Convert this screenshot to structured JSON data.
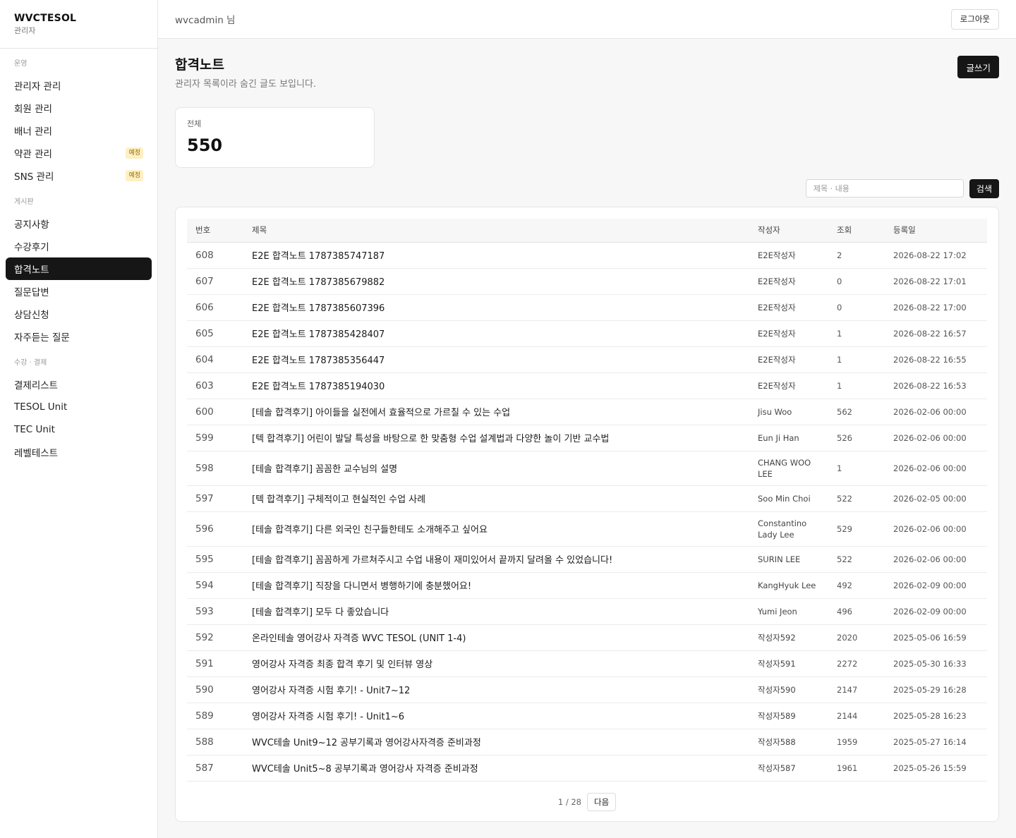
{
  "brand": {
    "name": "WVCTESOL",
    "sub": "관리자"
  },
  "sidebar": {
    "sections": [
      {
        "label": "운영",
        "items": [
          {
            "label": "관리자 관리"
          },
          {
            "label": "회원 관리"
          },
          {
            "label": "배너 관리"
          },
          {
            "label": "약관 관리",
            "badge": "예정"
          },
          {
            "label": "SNS 관리",
            "badge": "예정"
          }
        ]
      },
      {
        "label": "게시판",
        "items": [
          {
            "label": "공지사항"
          },
          {
            "label": "수강후기"
          },
          {
            "label": "합격노트",
            "active": true
          },
          {
            "label": "질문답변"
          },
          {
            "label": "상담신청"
          },
          {
            "label": "자주듣는 질문"
          }
        ]
      },
      {
        "label": "수강 · 결제",
        "items": [
          {
            "label": "결제리스트"
          },
          {
            "label": "TESOL Unit"
          },
          {
            "label": "TEC Unit"
          },
          {
            "label": "레벨테스트"
          }
        ]
      }
    ]
  },
  "topbar": {
    "user": "wvcadmin 님",
    "logout_label": "로그아웃"
  },
  "page": {
    "title": "합격노트",
    "description": "관리자 목록이라 숨긴 글도 보입니다.",
    "write_label": "글쓰기"
  },
  "stats": {
    "label": "전체",
    "value": "550"
  },
  "search": {
    "placeholder": "제목 · 내용",
    "button_label": "검색"
  },
  "table": {
    "columns": [
      "번호",
      "제목",
      "작성자",
      "조회",
      "등록일"
    ],
    "rows": [
      {
        "num": "608",
        "title": "E2E 합격노트 1787385747187",
        "author": "E2E작성자",
        "views": "2",
        "date": "2026-08-22 17:02"
      },
      {
        "num": "607",
        "title": "E2E 합격노트 1787385679882",
        "author": "E2E작성자",
        "views": "0",
        "date": "2026-08-22 17:01"
      },
      {
        "num": "606",
        "title": "E2E 합격노트 1787385607396",
        "author": "E2E작성자",
        "views": "0",
        "date": "2026-08-22 17:00"
      },
      {
        "num": "605",
        "title": "E2E 합격노트 1787385428407",
        "author": "E2E작성자",
        "views": "1",
        "date": "2026-08-22 16:57"
      },
      {
        "num": "604",
        "title": "E2E 합격노트 1787385356447",
        "author": "E2E작성자",
        "views": "1",
        "date": "2026-08-22 16:55"
      },
      {
        "num": "603",
        "title": "E2E 합격노트 1787385194030",
        "author": "E2E작성자",
        "views": "1",
        "date": "2026-08-22 16:53"
      },
      {
        "num": "600",
        "title": "[테솔 합격후기] 아이들을 실전에서 효율적으로 가르칠 수 있는 수업",
        "author": "Jisu Woo",
        "views": "562",
        "date": "2026-02-06 00:00"
      },
      {
        "num": "599",
        "title": "[텍 합격후기] 어린이 발달 특성을 바탕으로 한 맞춤형 수업 설계법과 다양한 놀이 기반 교수법",
        "author": "Eun Ji Han",
        "views": "526",
        "date": "2026-02-06 00:00"
      },
      {
        "num": "598",
        "title": "[테솔 합격후기] 꼼꼼한 교수님의 설명",
        "author": "CHANG WOO LEE",
        "views": "1",
        "date": "2026-02-06 00:00",
        "tall": true
      },
      {
        "num": "597",
        "title": "[텍 합격후기] 구체적이고 현실적인 수업 사례",
        "author": "Soo Min Choi",
        "views": "522",
        "date": "2026-02-05 00:00"
      },
      {
        "num": "596",
        "title": "[테솔 합격후기] 다른 외국인 친구들한테도 소개해주고 싶어요",
        "author": "Constantino Lady Lee",
        "views": "529",
        "date": "2026-02-06 00:00",
        "tall": true
      },
      {
        "num": "595",
        "title": "[테솔 합격후기] 꼼꼼하게 가르쳐주시고 수업 내용이 재미있어서 끝까지 달려올 수 있었습니다!",
        "author": "SURIN LEE",
        "views": "522",
        "date": "2026-02-06 00:00"
      },
      {
        "num": "594",
        "title": "[테솔 합격후기] 직장을 다니면서 병행하기에 충분했어요!",
        "author": "KangHyuk Lee",
        "views": "492",
        "date": "2026-02-09 00:00"
      },
      {
        "num": "593",
        "title": "[테솔 합격후기] 모두 다 좋았습니다",
        "author": "Yumi Jeon",
        "views": "496",
        "date": "2026-02-09 00:00"
      },
      {
        "num": "592",
        "title": "온라인테솔 영어강사 자격증 WVC TESOL (UNIT 1-4)",
        "author": "작성자592",
        "views": "2020",
        "date": "2025-05-06 16:59"
      },
      {
        "num": "591",
        "title": "영어강사 자격증 최종 합격 후기 및 인터뷰 영상",
        "author": "작성자591",
        "views": "2272",
        "date": "2025-05-30 16:33"
      },
      {
        "num": "590",
        "title": "영어강사 자격증 시험 후기! - Unit7~12",
        "author": "작성자590",
        "views": "2147",
        "date": "2025-05-29 16:28"
      },
      {
        "num": "589",
        "title": "영어강사 자격증 시험 후기! - Unit1~6",
        "author": "작성자589",
        "views": "2144",
        "date": "2025-05-28 16:23"
      },
      {
        "num": "588",
        "title": "WVC테솔 Unit9~12 공부기록과 영어강사자격증 준비과정",
        "author": "작성자588",
        "views": "1959",
        "date": "2025-05-27 16:14"
      },
      {
        "num": "587",
        "title": "WVC테솔 Unit5~8 공부기록과 영어강사 자격증 준비과정",
        "author": "작성자587",
        "views": "1961",
        "date": "2025-05-26 15:59"
      }
    ]
  },
  "pagination": {
    "info": "1 / 28",
    "next_label": "다음"
  }
}
